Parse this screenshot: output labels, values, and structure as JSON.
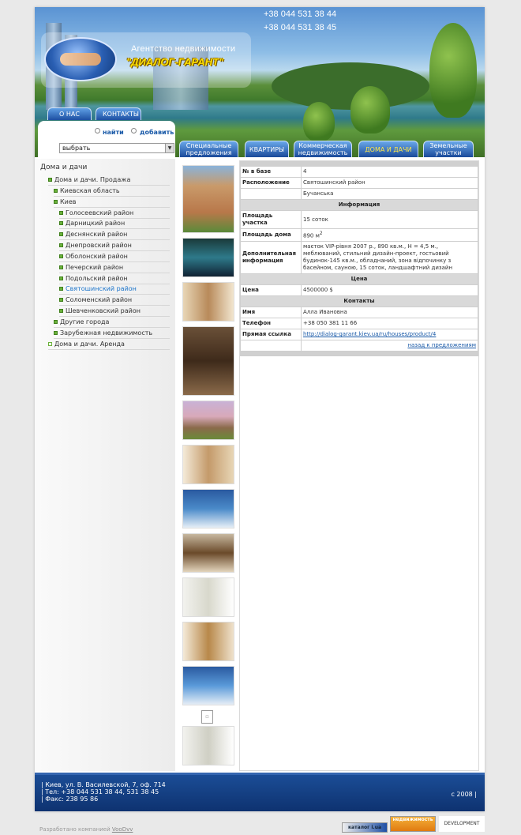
{
  "header": {
    "agency_label": "Агентство недвижимости",
    "agency_name": "\"ДИАЛОГ-ГАРАНТ\"",
    "phones": [
      "+38 044 531 38 44",
      "+38 044 531 38 45"
    ],
    "top_tabs": [
      "О НАС",
      "КОНТАКТЫ"
    ]
  },
  "search": {
    "radio_find": "найти",
    "radio_add": "добавить",
    "select_value": "выбрать"
  },
  "categories": [
    "Специальные предложения",
    "КВАРТИРЫ",
    "Коммерческая недвижимость",
    "ДОМА И ДАЧИ",
    "Земельные участки"
  ],
  "sidebar": {
    "title": "Дома и дачи",
    "items": [
      "Дома и дачи. Продажа",
      "Киевская область",
      "Киев",
      "Голосеевский район",
      "Дарницкий район",
      "Деснянский район",
      "Днепровский район",
      "Оболонский район",
      "Печерский район",
      "Подольский район",
      "Святошинский район",
      "Соломенский район",
      "Шевченковский район",
      "Другие города",
      "Зарубежная недвижимость",
      "Дома и дачи. Аренда"
    ]
  },
  "details": {
    "id_label": "№ в базе",
    "id_value": "4",
    "location_label": "Расположение",
    "location_value": "Святошинский район",
    "location_value2": "Бучанська",
    "section_info": "Информация",
    "plot_label": "Площадь участка",
    "plot_value": "15 соток",
    "house_label": "Площадь дома",
    "house_value": "890 м",
    "house_sup": "2",
    "extra_label": "Дополнительная информация",
    "extra_value": "маєток VIP-рівня 2007 р., 890 кв.м., H = 4,5 м., меблюваний, стильний дизайн-проект, гостьовий будинок-145 кв.м., обладнаний, зона відпочинку з басейном, сауною, 15 соток, ландшафтний дизайн",
    "section_price": "Цена",
    "price_label": "Цена",
    "price_value": "4500000 $",
    "section_contacts": "Контакты",
    "name_label": "Имя",
    "name_value": "Алла Ивановна",
    "phone_label": "Телефон",
    "phone_value": "+38 050 381 11 66",
    "link_label": "Прямая ссылка",
    "link_value": "http://dialog-garant.kiev.ua/ru/houses/product/4",
    "back_link": "назад к предложениям"
  },
  "footer": {
    "address": "| Киев, ул. В. Василевской, 7, оф. 714",
    "tel": "| Тел: +38 044 531 38 44, 531 38 45",
    "fax": "| Факс: 238 95 86",
    "copyright": "с 2008 |"
  },
  "credits": {
    "text": "Разработано компанией ",
    "company": "VooDvv",
    "badge_catalog": "каталог i.ua",
    "badge_realty": "недвижимость",
    "badge_dev": "DEVELOPMENT"
  }
}
